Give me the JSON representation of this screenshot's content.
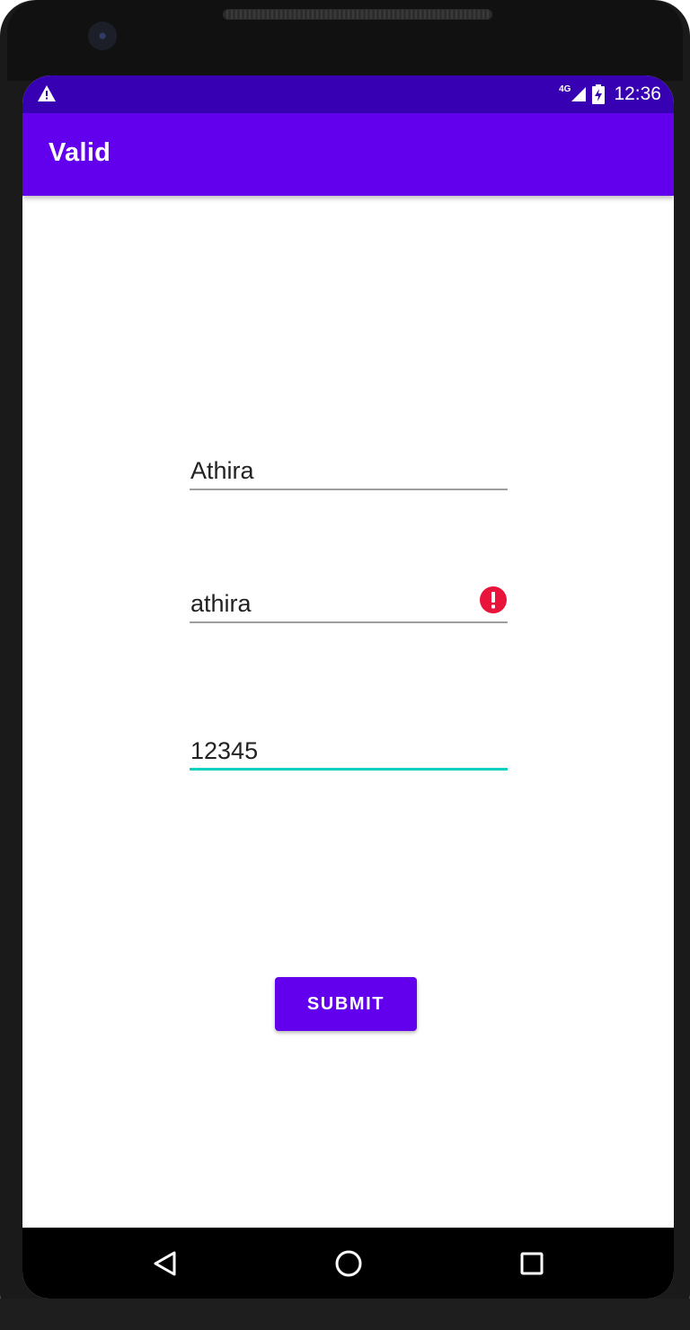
{
  "status_bar": {
    "network": "4G",
    "time": "12:36",
    "warning_icon": "warning-icon",
    "signal_icon": "signal-icon",
    "battery_icon": "battery-charging-icon"
  },
  "app_bar": {
    "title": "Valid"
  },
  "form": {
    "fields": [
      {
        "value": "Athira",
        "state": "normal"
      },
      {
        "value": "athira",
        "state": "error",
        "icon": "error-icon"
      },
      {
        "value": "12345",
        "state": "focused"
      }
    ],
    "submit_label": "SUBMIT"
  },
  "nav_bar": {
    "back_icon": "back-icon",
    "home_icon": "home-icon",
    "recents_icon": "recents-icon"
  },
  "colors": {
    "status_bar": "#3700b3",
    "primary": "#6200ee",
    "accent": "#10d0c0",
    "error": "#e8143c"
  }
}
